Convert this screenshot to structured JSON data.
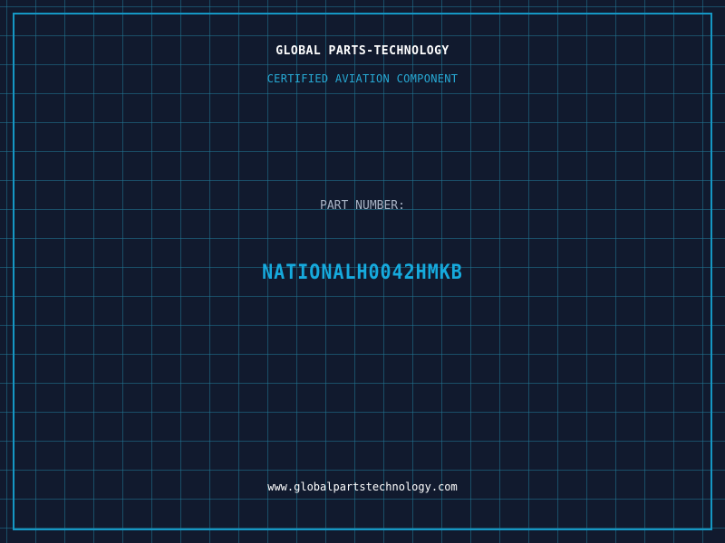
{
  "header": {
    "company": "GLOBAL PARTS-TECHNOLOGY",
    "subtitle": "CERTIFIED AVIATION COMPONENT"
  },
  "part": {
    "label": "PART NUMBER:",
    "number": "NATIONALH0042HMKB"
  },
  "footer": {
    "website": "www.globalpartstechnology.com"
  },
  "colors": {
    "background": "#111a2e",
    "grid": "#217896",
    "accent": "#16aadd",
    "frame": "#1597c4",
    "label": "#a9b4c6",
    "text": "#ffffff"
  }
}
